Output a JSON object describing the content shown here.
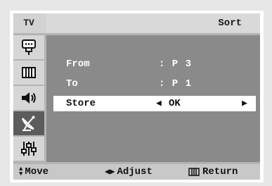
{
  "header": {
    "source_label": "TV",
    "title": "Sort"
  },
  "sidebar": {
    "items": [
      {
        "icon": "input-icon",
        "active": false
      },
      {
        "icon": "picture-icon",
        "active": false
      },
      {
        "icon": "sound-icon",
        "active": false
      },
      {
        "icon": "channel-icon",
        "active": true
      },
      {
        "icon": "setup-icon",
        "active": false
      }
    ]
  },
  "menu": {
    "rows": [
      {
        "label": "From",
        "value": ": P 3"
      },
      {
        "label": "To",
        "value": ": P 1"
      },
      {
        "label": "Store",
        "value": "OK"
      }
    ]
  },
  "footer": {
    "move_label": "Move",
    "adjust_label": "Adjust",
    "return_label": "Return"
  },
  "colors": {
    "content_bg": "#8a8a8a",
    "selected_row_bg": "#ffffff",
    "active_sidebar_bg": "#5c5c5c"
  }
}
